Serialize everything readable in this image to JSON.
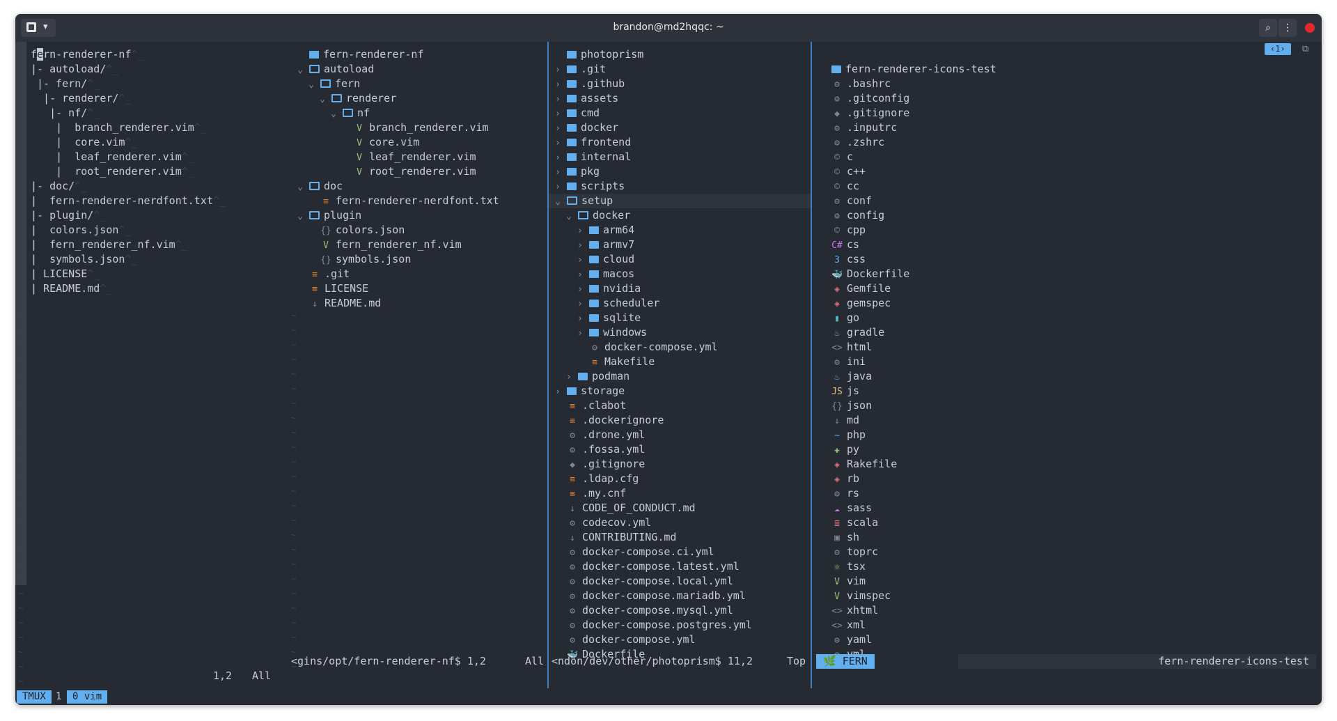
{
  "window": {
    "title": "brandon@md2hqqc: ~"
  },
  "pane1": {
    "lines": [
      {
        "text": "fern-renderer-nf",
        "suf": "^_"
      },
      {
        "text": "|- autoload/",
        "suf": "^_"
      },
      {
        "text": " |- fern/",
        "suf": "^_"
      },
      {
        "text": "  |- renderer/",
        "suf": "^_"
      },
      {
        "text": "   |- nf/",
        "suf": "^_"
      },
      {
        "text": "    |  branch_renderer.vim",
        "suf": "^_"
      },
      {
        "text": "    |  core.vim",
        "suf": "^_"
      },
      {
        "text": "    |  leaf_renderer.vim",
        "suf": "^_"
      },
      {
        "text": "    |  root_renderer.vim",
        "suf": "^_"
      },
      {
        "text": "|- doc/",
        "suf": "^_"
      },
      {
        "text": "|  fern-renderer-nerdfont.txt",
        "suf": "^_"
      },
      {
        "text": "|- plugin/",
        "suf": "^_"
      },
      {
        "text": "|  colors.json",
        "suf": "^_"
      },
      {
        "text": "|  fern_renderer_nf.vim",
        "suf": "^_"
      },
      {
        "text": "|  symbols.json",
        "suf": "^_"
      },
      {
        "text": "| LICENSE",
        "suf": "^_"
      },
      {
        "text": "| README.md",
        "suf": "^_"
      }
    ],
    "status_pos": "1,2",
    "status_all": "All"
  },
  "pane2": {
    "lines": [
      {
        "indent": 0,
        "chev": "",
        "icon": "folder",
        "color": "c-blue",
        "text": "fern-renderer-nf"
      },
      {
        "indent": 0,
        "chev": "⌄",
        "icon": "folder-open",
        "color": "c-blue",
        "text": "autoload"
      },
      {
        "indent": 1,
        "chev": "⌄",
        "icon": "folder-open",
        "color": "c-blue",
        "text": "fern"
      },
      {
        "indent": 2,
        "chev": "⌄",
        "icon": "folder-open",
        "color": "c-blue",
        "text": "renderer"
      },
      {
        "indent": 3,
        "chev": "⌄",
        "icon": "folder-open",
        "color": "c-blue",
        "text": "nf"
      },
      {
        "indent": 4,
        "chev": "",
        "icon": "V",
        "color": "c-green",
        "text": "branch_renderer.vim"
      },
      {
        "indent": 4,
        "chev": "",
        "icon": "V",
        "color": "c-green",
        "text": "core.vim"
      },
      {
        "indent": 4,
        "chev": "",
        "icon": "V",
        "color": "c-green",
        "text": "leaf_renderer.vim"
      },
      {
        "indent": 4,
        "chev": "",
        "icon": "V",
        "color": "c-green",
        "text": "root_renderer.vim"
      },
      {
        "indent": 0,
        "chev": "⌄",
        "icon": "folder-open",
        "color": "c-blue",
        "text": "doc"
      },
      {
        "indent": 1,
        "chev": "",
        "icon": "≡",
        "color": "c-orange",
        "text": "fern-renderer-nerdfont.txt"
      },
      {
        "indent": 0,
        "chev": "⌄",
        "icon": "folder-open",
        "color": "c-blue",
        "text": "plugin"
      },
      {
        "indent": 1,
        "chev": "",
        "icon": "{}",
        "color": "c-grey",
        "text": "colors.json"
      },
      {
        "indent": 1,
        "chev": "",
        "icon": "V",
        "color": "c-green",
        "text": "fern_renderer_nf.vim"
      },
      {
        "indent": 1,
        "chev": "",
        "icon": "{}",
        "color": "c-grey",
        "text": "symbols.json"
      },
      {
        "indent": 0,
        "chev": "",
        "icon": "≡",
        "color": "c-orange",
        "text": ".git"
      },
      {
        "indent": 0,
        "chev": "",
        "icon": "≡",
        "color": "c-orange",
        "text": "LICENSE"
      },
      {
        "indent": 0,
        "chev": "",
        "icon": "↓",
        "color": "c-grey",
        "text": "README.md"
      }
    ],
    "status_left": "<gins/opt/fern-renderer-nf$ 1,2",
    "status_right": "All"
  },
  "pane3": {
    "lines": [
      {
        "indent": 0,
        "chev": "",
        "icon": "folder",
        "text": "photoprism"
      },
      {
        "indent": 0,
        "chev": "›",
        "icon": "folder",
        "text": ".git"
      },
      {
        "indent": 0,
        "chev": "›",
        "icon": "folder",
        "text": ".github"
      },
      {
        "indent": 0,
        "chev": "›",
        "icon": "folder",
        "text": "assets"
      },
      {
        "indent": 0,
        "chev": "›",
        "icon": "folder",
        "text": "cmd"
      },
      {
        "indent": 0,
        "chev": "›",
        "icon": "folder",
        "text": "docker"
      },
      {
        "indent": 0,
        "chev": "›",
        "icon": "folder",
        "text": "frontend"
      },
      {
        "indent": 0,
        "chev": "›",
        "icon": "folder",
        "text": "internal"
      },
      {
        "indent": 0,
        "chev": "›",
        "icon": "folder",
        "text": "pkg"
      },
      {
        "indent": 0,
        "chev": "›",
        "icon": "folder",
        "text": "scripts"
      },
      {
        "indent": 0,
        "chev": "⌄",
        "icon": "folder-open",
        "text": "setup",
        "selected": true
      },
      {
        "indent": 1,
        "chev": "⌄",
        "icon": "folder-open",
        "text": "docker"
      },
      {
        "indent": 2,
        "chev": "›",
        "icon": "folder",
        "text": "arm64"
      },
      {
        "indent": 2,
        "chev": "›",
        "icon": "folder",
        "text": "armv7"
      },
      {
        "indent": 2,
        "chev": "›",
        "icon": "folder",
        "text": "cloud"
      },
      {
        "indent": 2,
        "chev": "›",
        "icon": "folder",
        "text": "macos"
      },
      {
        "indent": 2,
        "chev": "›",
        "icon": "folder",
        "text": "nvidia"
      },
      {
        "indent": 2,
        "chev": "›",
        "icon": "folder",
        "text": "scheduler"
      },
      {
        "indent": 2,
        "chev": "›",
        "icon": "folder",
        "text": "sqlite"
      },
      {
        "indent": 2,
        "chev": "›",
        "icon": "folder",
        "text": "windows"
      },
      {
        "indent": 2,
        "chev": "",
        "icon": "⚙",
        "color": "c-grey",
        "text": "docker-compose.yml"
      },
      {
        "indent": 2,
        "chev": "",
        "icon": "≡",
        "color": "c-orange",
        "text": "Makefile"
      },
      {
        "indent": 1,
        "chev": "›",
        "icon": "folder",
        "text": "podman"
      },
      {
        "indent": 0,
        "chev": "›",
        "icon": "folder",
        "text": "storage"
      },
      {
        "indent": 0,
        "chev": "",
        "icon": "≡",
        "color": "c-orange",
        "text": ".clabot"
      },
      {
        "indent": 0,
        "chev": "",
        "icon": "≡",
        "color": "c-orange",
        "text": ".dockerignore"
      },
      {
        "indent": 0,
        "chev": "",
        "icon": "⚙",
        "color": "c-grey",
        "text": ".drone.yml"
      },
      {
        "indent": 0,
        "chev": "",
        "icon": "⚙",
        "color": "c-grey",
        "text": ".fossa.yml"
      },
      {
        "indent": 0,
        "chev": "",
        "icon": "◆",
        "color": "c-grey",
        "text": ".gitignore"
      },
      {
        "indent": 0,
        "chev": "",
        "icon": "≡",
        "color": "c-orange",
        "text": ".ldap.cfg"
      },
      {
        "indent": 0,
        "chev": "",
        "icon": "≡",
        "color": "c-orange",
        "text": ".my.cnf"
      },
      {
        "indent": 0,
        "chev": "",
        "icon": "↓",
        "color": "c-grey",
        "text": "CODE_OF_CONDUCT.md"
      },
      {
        "indent": 0,
        "chev": "",
        "icon": "⚙",
        "color": "c-grey",
        "text": "codecov.yml"
      },
      {
        "indent": 0,
        "chev": "",
        "icon": "↓",
        "color": "c-grey",
        "text": "CONTRIBUTING.md"
      },
      {
        "indent": 0,
        "chev": "",
        "icon": "⚙",
        "color": "c-grey",
        "text": "docker-compose.ci.yml"
      },
      {
        "indent": 0,
        "chev": "",
        "icon": "⚙",
        "color": "c-grey",
        "text": "docker-compose.latest.yml"
      },
      {
        "indent": 0,
        "chev": "",
        "icon": "⚙",
        "color": "c-grey",
        "text": "docker-compose.local.yml"
      },
      {
        "indent": 0,
        "chev": "",
        "icon": "⚙",
        "color": "c-grey",
        "text": "docker-compose.mariadb.yml"
      },
      {
        "indent": 0,
        "chev": "",
        "icon": "⚙",
        "color": "c-grey",
        "text": "docker-compose.mysql.yml"
      },
      {
        "indent": 0,
        "chev": "",
        "icon": "⚙",
        "color": "c-grey",
        "text": "docker-compose.postgres.yml"
      },
      {
        "indent": 0,
        "chev": "",
        "icon": "⚙",
        "color": "c-grey",
        "text": "docker-compose.yml"
      },
      {
        "indent": 0,
        "chev": "",
        "icon": "🐳",
        "color": "c-blue",
        "text": "Dockerfile"
      }
    ],
    "status_left": "<ndon/dev/other/photoprism$ 11,2",
    "status_right": "Top"
  },
  "pane4": {
    "tab_label": "‹1›",
    "lines": [
      {
        "icon": "folder",
        "color": "c-blue",
        "text": "fern-renderer-icons-test"
      },
      {
        "icon": "⚙",
        "color": "c-grey",
        "text": ".bashrc"
      },
      {
        "icon": "⚙",
        "color": "c-grey",
        "text": ".gitconfig"
      },
      {
        "icon": "◆",
        "color": "c-grey",
        "text": ".gitignore"
      },
      {
        "icon": "⚙",
        "color": "c-grey",
        "text": ".inputrc"
      },
      {
        "icon": "⚙",
        "color": "c-grey",
        "text": ".zshrc"
      },
      {
        "icon": "©",
        "color": "c-grey",
        "text": "c"
      },
      {
        "icon": "©",
        "color": "c-grey",
        "text": "c++"
      },
      {
        "icon": "©",
        "color": "c-grey",
        "text": "cc"
      },
      {
        "icon": "⚙",
        "color": "c-grey",
        "text": "conf"
      },
      {
        "icon": "⚙",
        "color": "c-grey",
        "text": "config"
      },
      {
        "icon": "©",
        "color": "c-grey",
        "text": "cpp"
      },
      {
        "icon": "C#",
        "color": "c-purple",
        "text": "cs"
      },
      {
        "icon": "3",
        "color": "c-blue",
        "text": "css"
      },
      {
        "icon": "🐳",
        "color": "c-blue",
        "text": "Dockerfile"
      },
      {
        "icon": "◈",
        "color": "c-red",
        "text": "Gemfile"
      },
      {
        "icon": "◈",
        "color": "c-red",
        "text": "gemspec"
      },
      {
        "icon": "▮",
        "color": "c-cyan",
        "text": "go"
      },
      {
        "icon": "♨",
        "color": "c-blue",
        "text": "gradle"
      },
      {
        "icon": "<>",
        "color": "c-grey",
        "text": "html"
      },
      {
        "icon": "⚙",
        "color": "c-grey",
        "text": "ini"
      },
      {
        "icon": "♨",
        "color": "c-blue",
        "text": "java"
      },
      {
        "icon": "JS",
        "color": "c-yellow",
        "text": "js"
      },
      {
        "icon": "{}",
        "color": "c-grey",
        "text": "json"
      },
      {
        "icon": "↓",
        "color": "c-grey",
        "text": "md"
      },
      {
        "icon": "~",
        "color": "c-blue",
        "text": "php"
      },
      {
        "icon": "✚",
        "color": "c-green",
        "text": "py"
      },
      {
        "icon": "◈",
        "color": "c-red",
        "text": "Rakefile"
      },
      {
        "icon": "◈",
        "color": "c-red",
        "text": "rb"
      },
      {
        "icon": "⚙",
        "color": "c-grey",
        "text": "rs"
      },
      {
        "icon": "☁",
        "color": "c-purple",
        "text": "sass"
      },
      {
        "icon": "≣",
        "color": "c-red",
        "text": "scala"
      },
      {
        "icon": "▣",
        "color": "c-grey",
        "text": "sh"
      },
      {
        "icon": "⚙",
        "color": "c-grey",
        "text": "toprc"
      },
      {
        "icon": "⚛",
        "color": "c-green",
        "text": "tsx"
      },
      {
        "icon": "V",
        "color": "c-green",
        "text": "vim"
      },
      {
        "icon": "V",
        "color": "c-green",
        "text": "vimspec"
      },
      {
        "icon": "<>",
        "color": "c-grey",
        "text": "xhtml"
      },
      {
        "icon": "<>",
        "color": "c-grey",
        "text": "xml"
      },
      {
        "icon": "⚙",
        "color": "c-grey",
        "text": "yaml"
      },
      {
        "icon": "⚙",
        "color": "c-grey",
        "text": "yml"
      }
    ],
    "status_mode": "🌿 FERN",
    "status_name": "fern-renderer-icons-test"
  },
  "tmux": {
    "session": "TMUX",
    "index": "1",
    "window": "0 vim"
  },
  "colors": {
    "accent": "#61afef",
    "bg": "#262a33",
    "separator": "#3d7fc0"
  }
}
